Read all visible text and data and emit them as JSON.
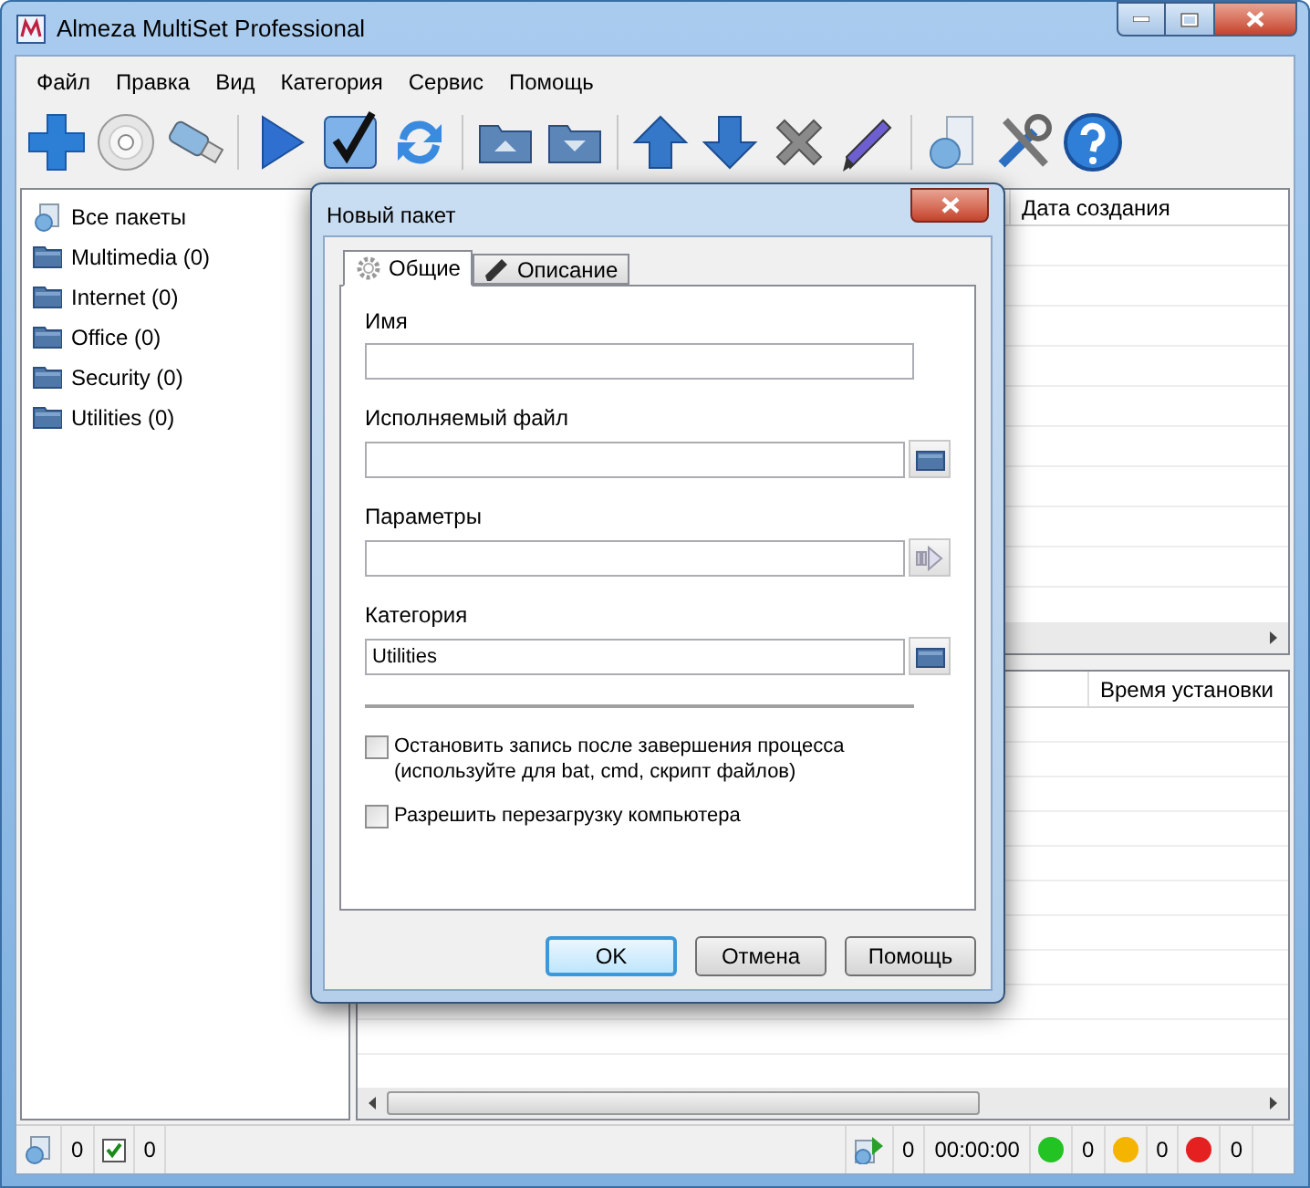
{
  "window": {
    "title": "Almeza MultiSet Professional"
  },
  "menu": [
    "Файл",
    "Правка",
    "Вид",
    "Категория",
    "Сервис",
    "Помощь"
  ],
  "tree": [
    {
      "kind": "all",
      "label": "Все пакеты"
    },
    {
      "kind": "folder",
      "label": "Multimedia (0)"
    },
    {
      "kind": "folder",
      "label": "Internet (0)"
    },
    {
      "kind": "folder",
      "label": "Office (0)"
    },
    {
      "kind": "folder",
      "label": "Security (0)"
    },
    {
      "kind": "folder",
      "label": "Utilities (0)"
    }
  ],
  "top_list": {
    "columns": [
      "Дата создания"
    ]
  },
  "bottom_list": {
    "columns": [
      "Время установки"
    ]
  },
  "dialog": {
    "title": "Новый пакет",
    "tabs": [
      {
        "label": "Общие",
        "kind": "gear",
        "selected": true
      },
      {
        "label": "Описание",
        "kind": "pencil",
        "selected": false
      }
    ],
    "fields": [
      {
        "label": "Имя",
        "kind": "plain"
      },
      {
        "label": "Исполняемый файл",
        "kind": "folder"
      },
      {
        "label": "Параметры",
        "kind": "arrow"
      },
      {
        "label": "Категория",
        "value": "Utilities",
        "kind": "folder"
      }
    ],
    "checkboxes": [
      {
        "label": "Остановить запись после завершения процесса\n(используйте для  bat, cmd, скрипт файлов)",
        "checked": false
      },
      {
        "label": "Разрешить перезагрузку компьютера",
        "checked": false
      }
    ],
    "buttons": [
      {
        "label": "OK",
        "default": true
      },
      {
        "label": "Отмена",
        "default": false
      },
      {
        "label": "Помощь",
        "default": false
      }
    ]
  },
  "status_bar": {
    "left": [
      {
        "kind": "packages",
        "text": "0"
      },
      {
        "kind": "check",
        "text": "0"
      }
    ],
    "right": [
      {
        "kind": "run",
        "text": "0"
      },
      {
        "kind": "time",
        "text": "00:00:00"
      },
      {
        "kind": "dot",
        "color": "#22c322",
        "text": "0"
      },
      {
        "kind": "dot",
        "color": "#f5b400",
        "text": "0"
      },
      {
        "kind": "dot",
        "color": "#e52020",
        "text": "0"
      }
    ]
  }
}
